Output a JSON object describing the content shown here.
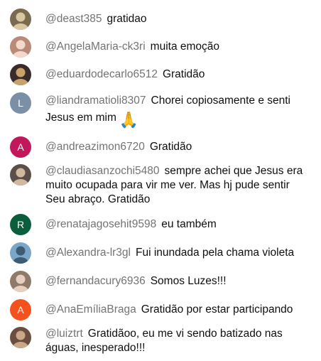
{
  "messages": [
    {
      "author": "@deast385",
      "text": "gratidao",
      "avatar": {
        "kind": "photo",
        "icon": "photo-avatar-icon",
        "bg": "#7a6a4f",
        "fg": "#d9c7a1"
      }
    },
    {
      "author": "@AngelaMaria-ck3ri",
      "text": "muita emoção",
      "avatar": {
        "kind": "photo",
        "icon": "photo-avatar-icon",
        "bg": "#b98a78",
        "fg": "#f2d9cc"
      }
    },
    {
      "author": "@eduardodecarlo6512",
      "text": "Gratidão",
      "avatar": {
        "kind": "photo",
        "icon": "photo-avatar-icon",
        "bg": "#3a2b2b",
        "fg": "#c9a26b"
      }
    },
    {
      "author": "@liandramatioli8307",
      "text": "Chorei copiosamente e senti Jesus em mim",
      "emoji": "🙏",
      "avatar": {
        "kind": "letter",
        "letter": "L",
        "bg": "#7b8fa6"
      }
    },
    {
      "author": "@andreazimon6720",
      "text": "Gratidão",
      "avatar": {
        "kind": "letter",
        "letter": "A",
        "bg": "#c2185b"
      }
    },
    {
      "author": "@claudiasanzochi5480",
      "text": "sempre achei que Jesus era muito ocupada para vir me ver. Mas hj pude sentir Seu abraço. Gratidão",
      "avatar": {
        "kind": "photo",
        "icon": "photo-avatar-icon",
        "bg": "#5b5049",
        "fg": "#d3b8a0"
      }
    },
    {
      "author": "@renatajagosehit9598",
      "text": "eu também",
      "avatar": {
        "kind": "letter",
        "letter": "R",
        "bg": "#0b5e3b"
      }
    },
    {
      "author": "@Alexandra-lr3gl",
      "text": "Fui inundada pela chama violeta",
      "avatar": {
        "kind": "photo",
        "icon": "photo-avatar-icon",
        "bg": "#7aa7c9",
        "fg": "#3d5b73"
      }
    },
    {
      "author": "@fernandacury6936",
      "text": "Somos Luzes!!!",
      "avatar": {
        "kind": "photo",
        "icon": "photo-avatar-icon",
        "bg": "#8f7a6a",
        "fg": "#e7cfc0"
      }
    },
    {
      "author": "@AnaEmíliaBraga",
      "text": "Gratidão por estar participando",
      "avatar": {
        "kind": "letter",
        "letter": "A",
        "bg": "#f4511e"
      }
    },
    {
      "author": "@luiztrt",
      "text": "Gratidãoo, eu me vi sendo batizado nas águas, inesperado!!!",
      "avatar": {
        "kind": "photo",
        "icon": "photo-avatar-icon",
        "bg": "#6a4f3e",
        "fg": "#caa786"
      }
    }
  ]
}
